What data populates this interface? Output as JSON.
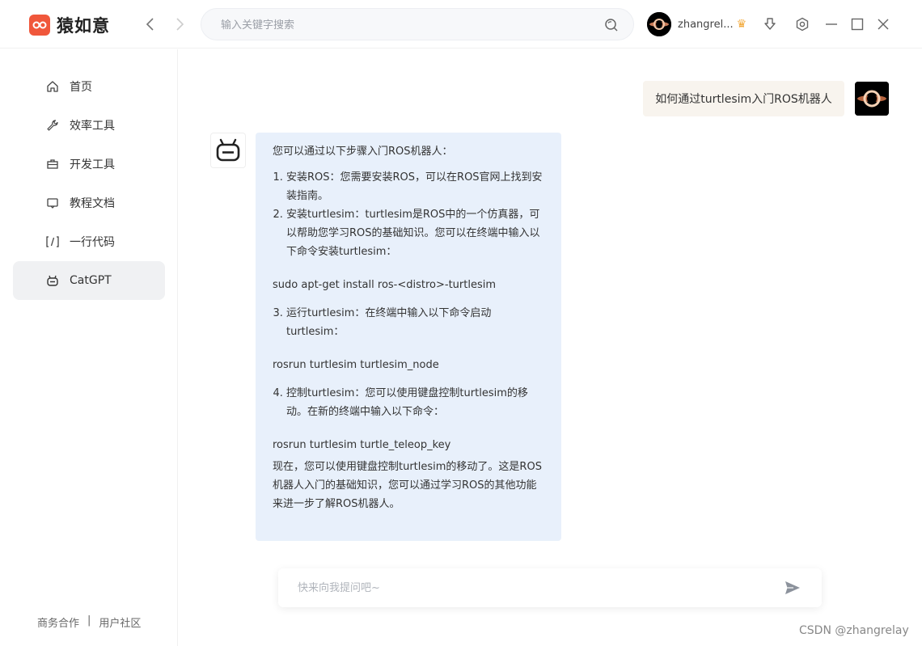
{
  "app": {
    "name": "猿如意"
  },
  "search": {
    "placeholder": "输入关键字搜索"
  },
  "user": {
    "name": "zhangrel..."
  },
  "sidebar": {
    "items": [
      {
        "label": "首页"
      },
      {
        "label": "效率工具"
      },
      {
        "label": "开发工具"
      },
      {
        "label": "教程文档"
      },
      {
        "label": "一行代码"
      },
      {
        "label": "CatGPT",
        "active": true
      }
    ],
    "footer": {
      "business": "商务合作",
      "separator": "|",
      "community": "用户社区"
    }
  },
  "chat": {
    "user_message": "如何通过turtlesim入门ROS机器人",
    "bot": {
      "intro": "您可以通过以下步骤入门ROS机器人：",
      "step1": "安装ROS：您需要安装ROS，可以在ROS官网上找到安装指南。",
      "step2": "安装turtlesim：turtlesim是ROS中的一个仿真器，可以帮助您学习ROS的基础知识。您可以在终端中输入以下命令安装turtlesim：",
      "cmd1": "sudo apt-get install ros-<distro>-turtlesim",
      "step3": "运行turtlesim：在终端中输入以下命令启动turtlesim：",
      "cmd2": "rosrun turtlesim turtlesim_node",
      "step4": "控制turtlesim：您可以使用键盘控制turtlesim的移动。在新的终端中输入以下命令：",
      "cmd3": "rosrun turtlesim turtle_teleop_key",
      "outro": "现在，您可以使用键盘控制turtlesim的移动了。这是ROS机器人入门的基础知识，您可以通过学习ROS的其他功能来进一步了解ROS机器人。"
    }
  },
  "composer": {
    "placeholder": "快来向我提问吧~"
  },
  "watermark": "CSDN @zhangrelay",
  "colors": {
    "brand": "#f0573b",
    "bot_bubble": "#e8f0fb",
    "user_bubble": "#f8f4ee",
    "active_item": "#f0f1f3"
  }
}
